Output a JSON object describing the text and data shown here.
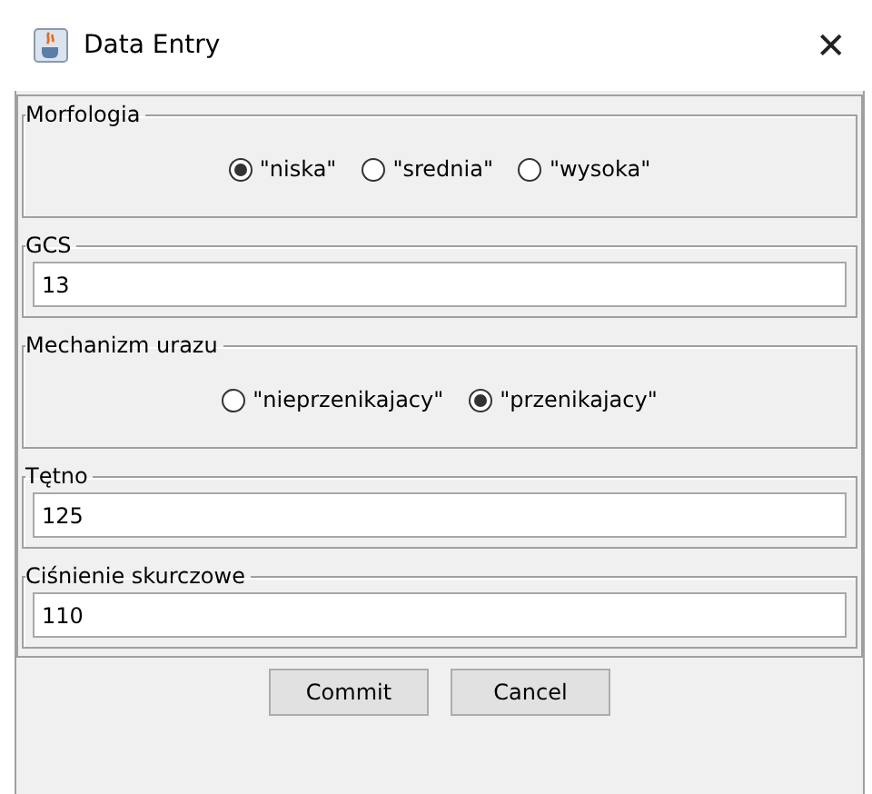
{
  "window": {
    "title": "Data Entry",
    "close": "✕"
  },
  "sections": [
    {
      "kind": "radio",
      "label": "Morfologia",
      "options": [
        {
          "label": "\"niska\"",
          "selected": true
        },
        {
          "label": "\"srednia\"",
          "selected": false
        },
        {
          "label": "\"wysoka\"",
          "selected": false
        }
      ]
    },
    {
      "kind": "field",
      "label": "GCS",
      "value": "13"
    },
    {
      "kind": "radio",
      "label": "Mechanizm urazu",
      "options": [
        {
          "label": "\"nieprzenikajacy\"",
          "selected": false
        },
        {
          "label": "\"przenikajacy\"",
          "selected": true
        }
      ]
    },
    {
      "kind": "field",
      "label": "Tętno",
      "value": "125"
    },
    {
      "kind": "field",
      "label": "Ciśnienie skurczowe",
      "value": "110"
    }
  ],
  "buttons": [
    "Commit",
    "Cancel"
  ]
}
